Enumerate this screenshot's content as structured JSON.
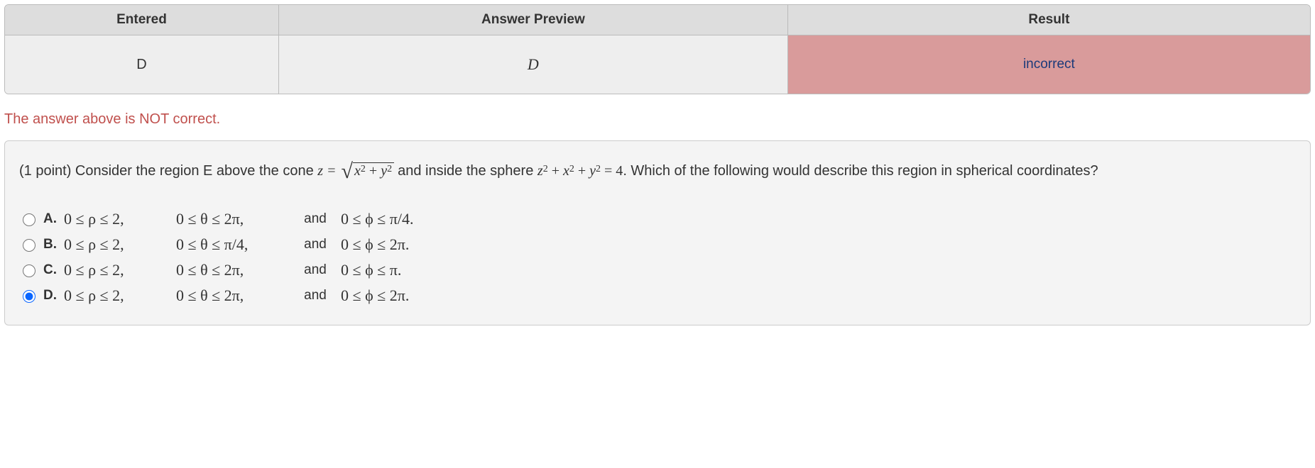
{
  "table": {
    "headers": {
      "entered": "Entered",
      "preview": "Answer Preview",
      "result": "Result"
    },
    "row": {
      "entered": "D",
      "preview": "D",
      "result": "incorrect"
    }
  },
  "feedback": "The answer above is NOT correct.",
  "question": {
    "prefix": "(1 point) Consider the region E above the cone ",
    "eq1_lhs": "z = ",
    "eq1_radicand_a": "x",
    "eq1_radicand_b": "y",
    "mid": " and inside the sphere ",
    "eq2": "z² + x² + y² = 4",
    "suffix": ". Which of the following would describe this region in spherical coordinates?"
  },
  "choices": [
    {
      "label": "A.",
      "rho": "0 ≤ ρ ≤ 2,",
      "theta": "0 ≤ θ ≤ 2π,",
      "and": "and",
      "phi": "0 ≤ ϕ ≤ π/4.",
      "checked": false
    },
    {
      "label": "B.",
      "rho": "0 ≤ ρ ≤ 2,",
      "theta": "0 ≤ θ ≤ π/4,",
      "and": "and",
      "phi": "0 ≤ ϕ ≤ 2π.",
      "checked": false
    },
    {
      "label": "C.",
      "rho": "0 ≤ ρ ≤ 2,",
      "theta": "0 ≤ θ ≤ 2π,",
      "and": "and",
      "phi": "0 ≤ ϕ ≤ π.",
      "checked": false
    },
    {
      "label": "D.",
      "rho": "0 ≤ ρ ≤ 2,",
      "theta": "0 ≤ θ ≤ 2π,",
      "and": "and",
      "phi": "0 ≤ ϕ ≤ 2π.",
      "checked": true
    }
  ]
}
